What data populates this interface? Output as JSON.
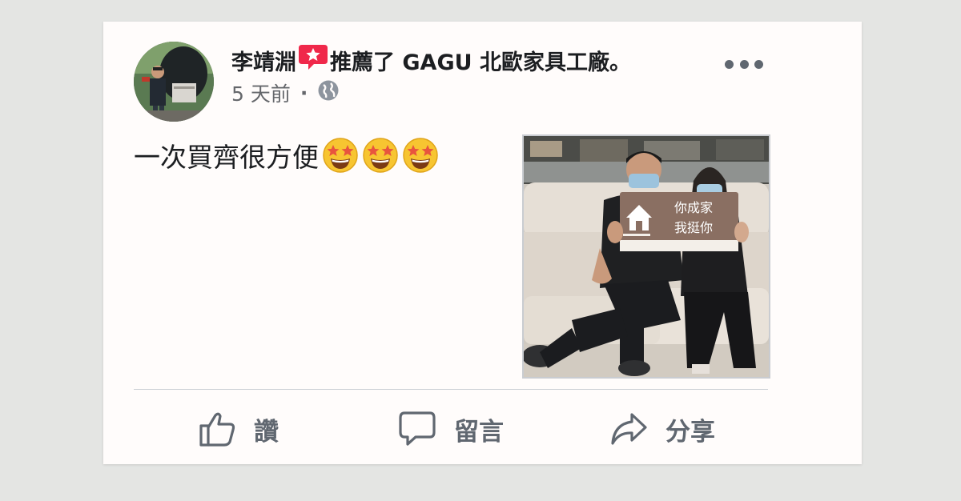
{
  "post": {
    "author": "李靖淵",
    "action": "推薦了 GAGU 北歐家具工廠。",
    "time": "5 天前",
    "separator": "·",
    "body": "一次買齊很方便",
    "emoji_count": 3
  },
  "photo": {
    "sign_line1": "你成家",
    "sign_line2": "我挺你"
  },
  "actions": {
    "like_label": "讚",
    "comment_label": "留言",
    "share_label": "分享"
  },
  "colors": {
    "recommend_red": "#f0284a",
    "text_primary": "#1c1e21",
    "text_secondary": "#65676b",
    "icon_grey": "#606770",
    "sign_brown": "#8a6f62"
  },
  "icons": {
    "recommend": "recommend-star-icon",
    "privacy": "globe-icon",
    "like": "thumbs-up-icon",
    "comment": "comment-bubble-icon",
    "share": "share-arrow-icon",
    "menu": "more-dots-icon"
  }
}
